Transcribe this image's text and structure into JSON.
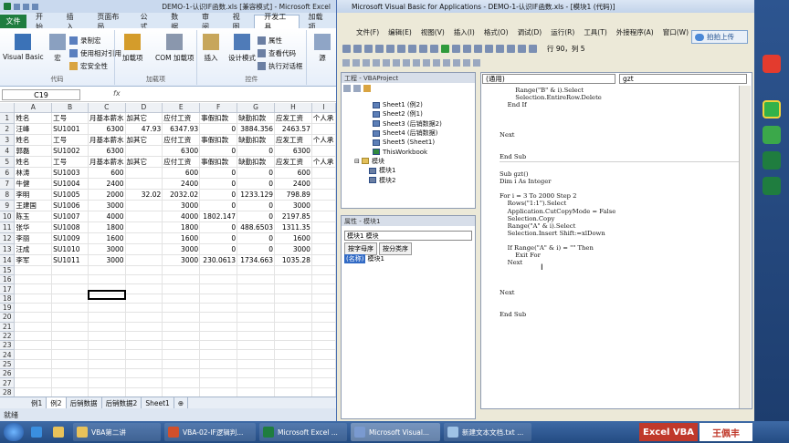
{
  "excel": {
    "title": "DEMO-1-认识IF函数.xls [兼容模式] - Microsoft Excel",
    "file_tab": "文件",
    "tabs": [
      "开始",
      "插入",
      "页面布局",
      "公式",
      "数据",
      "审阅",
      "视图",
      "开发工具",
      "加载项"
    ],
    "active_tab": "开发工具",
    "ribbon": {
      "code_group": "代码",
      "vb": "Visual Basic",
      "macro": "宏",
      "record": "录制宏",
      "relative": "使用相对引用",
      "security": "宏安全性",
      "addins_group": "加载项",
      "addins": "加载项",
      "com_addins": "COM 加载项",
      "controls_group": "控件",
      "insert": "插入",
      "design": "设计模式",
      "properties": "属性",
      "view_code": "查看代码",
      "run_dialog": "执行对话框",
      "source": "源"
    },
    "name_box": "C19",
    "fx": "fx",
    "columns": [
      "A",
      "B",
      "C",
      "D",
      "E",
      "F",
      "G",
      "H",
      "I"
    ],
    "rows": [
      [
        "1",
        "姓名",
        "工号",
        "月基本薪水",
        "加其它",
        "应付工资",
        "事假扣款",
        "缺勤扣款",
        "应发工资",
        "个人承"
      ],
      [
        "2",
        "汪峰",
        "SU1001",
        "6300",
        "47.93",
        "6347.93",
        "0",
        "3884.356",
        "2463.57",
        ""
      ],
      [
        "3",
        "姓名",
        "工号",
        "月基本薪水",
        "加其它",
        "应付工资",
        "事假扣款",
        "缺勤扣款",
        "应发工资",
        "个人承"
      ],
      [
        "4",
        "郭磊",
        "SU1002",
        "6300",
        "",
        "6300",
        "0",
        "0",
        "6300",
        ""
      ],
      [
        "5",
        "姓名",
        "工号",
        "月基本薪水",
        "加其它",
        "应付工资",
        "事假扣款",
        "缺勤扣款",
        "应发工资",
        "个人承"
      ],
      [
        "6",
        "林涛",
        "SU1003",
        "600",
        "",
        "600",
        "0",
        "0",
        "600",
        ""
      ],
      [
        "7",
        "牛健",
        "SU1004",
        "2400",
        "",
        "2400",
        "0",
        "0",
        "2400",
        ""
      ],
      [
        "8",
        "李明",
        "SU1005",
        "2000",
        "32.02",
        "2032.02",
        "0",
        "1233.129",
        "798.89",
        ""
      ],
      [
        "9",
        "王建国",
        "SU1006",
        "3000",
        "",
        "3000",
        "0",
        "0",
        "3000",
        ""
      ],
      [
        "10",
        "陈玉",
        "SU1007",
        "4000",
        "",
        "4000",
        "1802.147",
        "0",
        "2197.85",
        ""
      ],
      [
        "11",
        "张华",
        "SU1008",
        "1800",
        "",
        "1800",
        "0",
        "488.6503",
        "1311.35",
        ""
      ],
      [
        "12",
        "李丽",
        "SU1009",
        "1600",
        "",
        "1600",
        "0",
        "0",
        "1600",
        ""
      ],
      [
        "13",
        "汪成",
        "SU1010",
        "3000",
        "",
        "3000",
        "0",
        "0",
        "3000",
        ""
      ],
      [
        "14",
        "李军",
        "SU1011",
        "3000",
        "",
        "3000",
        "230.0613",
        "1734.663",
        "1035.28",
        ""
      ],
      [
        "15",
        "",
        "",
        "",
        "",
        "",
        "",
        "",
        "",
        ""
      ],
      [
        "16",
        "",
        "",
        "",
        "",
        "",
        "",
        "",
        "",
        ""
      ],
      [
        "17",
        "",
        "",
        "",
        "",
        "",
        "",
        "",
        "",
        ""
      ],
      [
        "18",
        "",
        "",
        "",
        "",
        "",
        "",
        "",
        "",
        ""
      ],
      [
        "19",
        "",
        "",
        "",
        "",
        "",
        "",
        "",
        "",
        ""
      ],
      [
        "20",
        "",
        "",
        "",
        "",
        "",
        "",
        "",
        "",
        ""
      ],
      [
        "21",
        "",
        "",
        "",
        "",
        "",
        "",
        "",
        "",
        ""
      ],
      [
        "22",
        "",
        "",
        "",
        "",
        "",
        "",
        "",
        "",
        ""
      ],
      [
        "23",
        "",
        "",
        "",
        "",
        "",
        "",
        "",
        "",
        ""
      ],
      [
        "24",
        "",
        "",
        "",
        "",
        "",
        "",
        "",
        "",
        ""
      ],
      [
        "25",
        "",
        "",
        "",
        "",
        "",
        "",
        "",
        "",
        ""
      ],
      [
        "26",
        "",
        "",
        "",
        "",
        "",
        "",
        "",
        "",
        ""
      ],
      [
        "27",
        "",
        "",
        "",
        "",
        "",
        "",
        "",
        "",
        ""
      ],
      [
        "28",
        "",
        "",
        "",
        "",
        "",
        "",
        "",
        "",
        ""
      ],
      [
        "29",
        "",
        "",
        "",
        "",
        "",
        "",
        "",
        "",
        ""
      ],
      [
        "30",
        "",
        "",
        "",
        "",
        "",
        "",
        "",
        "",
        ""
      ],
      [
        "31",
        "",
        "",
        "",
        "",
        "",
        "",
        "",
        "",
        ""
      ]
    ],
    "sheet_tabs": [
      "例1",
      "例2",
      "后销数据",
      "后销数据2",
      "Sheet1"
    ],
    "active_sheet": "例2",
    "status": "就绪"
  },
  "vbe": {
    "title": "Microsoft Visual Basic for Applications - DEMO-1-认识IF函数.xls - [模块1 (代码)]",
    "menu": [
      "文件(F)",
      "编辑(E)",
      "视图(V)",
      "插入(I)",
      "格式(O)",
      "调试(D)",
      "运行(R)",
      "工具(T)",
      "外接程序(A)",
      "窗口(W)"
    ],
    "position": "行 90，列 5",
    "project_title": "工程 - VBAProject",
    "tree": [
      "Sheet1 (例2)",
      "Sheet2 (例1)",
      "Sheet3 (后销数据2)",
      "Sheet4 (后销数据)",
      "Sheet5 (Sheet1)",
      "ThisWorkbook",
      "模块",
      "模块1",
      "模块2"
    ],
    "props_title": "属性 - 模块1",
    "props_combo": "模块1 模块",
    "props_tabs": [
      "按字母序",
      "按分类序"
    ],
    "props_key": "(名称)",
    "props_val": "模块1",
    "combo_left": "(通用)",
    "combo_right": "gzt",
    "code": [
      "        Range(\"B\" & i).Select",
      "        Selection.EntireRow.Delete",
      "    End If",
      "",
      "",
      "",
      "Next",
      "",
      "",
      "End Sub",
      "---",
      "",
      "Sub gzt()",
      "Dim i As Integer",
      "",
      "For i = 3 To 2000 Step 2",
      "    Rows(\"1:1\").Select",
      "    Application.CutCopyMode = False",
      "    Selection.Copy",
      "    Range(\"A\" & i).Select",
      "    Selection.Insert Shift:=xlDown",
      "",
      "    If Range(\"A\" & i) = \"\" Then",
      "        Exit For",
      "    Next",
      "",
      "",
      "",
      "Next",
      "",
      "",
      "End Sub"
    ],
    "cloud": "拍拍上传"
  },
  "taskbar": {
    "tasks": [
      "VBA第二讲",
      "VBA-02-IF逻辑判...",
      "Microsoft Excel ...",
      "Microsoft Visual...",
      "新建文本文档.txt ..."
    ],
    "brand": "Excel VBA",
    "author": "王佩丰"
  }
}
